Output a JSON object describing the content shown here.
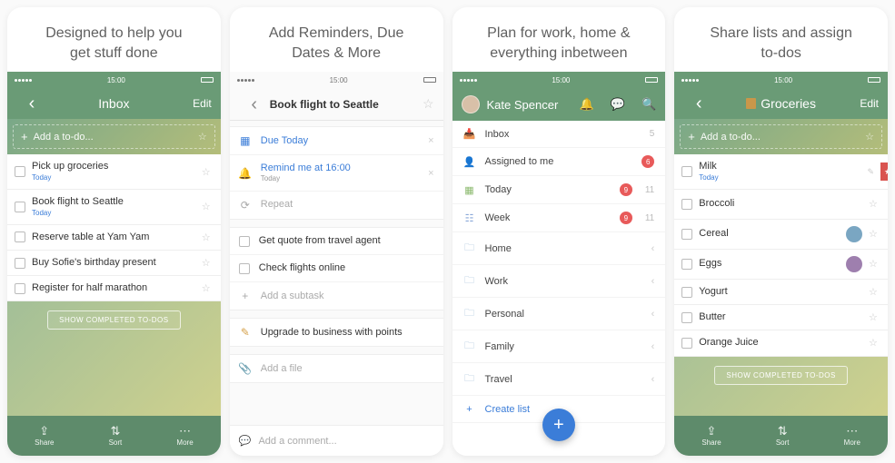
{
  "captions": {
    "c1l1": "Designed to help you",
    "c1l2": "get stuff done",
    "c2l1": "Add Reminders, Due",
    "c2l2": "Dates & More",
    "c3l1": "Plan for work, home &",
    "c3l2": "everything inbetween",
    "c4l1": "Share lists and assign",
    "c4l2": "to-dos"
  },
  "status_time": "15:00",
  "s1": {
    "title": "Inbox",
    "edit": "Edit",
    "add_placeholder": "Add a to-do...",
    "tasks": {
      "t0": {
        "title": "Pick up groceries",
        "sub": "Today"
      },
      "t1": {
        "title": "Book flight to Seattle",
        "sub": "Today"
      },
      "t2": {
        "title": "Reserve table at Yam Yam"
      },
      "t3": {
        "title": "Buy Sofie's birthday present"
      },
      "t4": {
        "title": "Register for half marathon"
      }
    },
    "show_completed": "SHOW COMPLETED TO-DOS"
  },
  "s2": {
    "title": "Book flight to Seattle",
    "due": "Due Today",
    "remind": "Remind me at 16:00",
    "remind_sub": "Today",
    "repeat": "Repeat",
    "sub0": "Get quote from travel agent",
    "sub1": "Check flights online",
    "add_sub": "Add a subtask",
    "note": "Upgrade to business with points",
    "add_file": "Add a file",
    "comment": "Add a comment..."
  },
  "s3": {
    "name": "Kate Spencer",
    "rows": {
      "inbox": {
        "label": "Inbox",
        "count": "5"
      },
      "assigned": {
        "label": "Assigned to me",
        "badge": "6"
      },
      "today": {
        "label": "Today",
        "badge": "9",
        "count": "11"
      },
      "week": {
        "label": "Week",
        "badge": "9",
        "count": "11"
      },
      "home": {
        "label": "Home"
      },
      "work": {
        "label": "Work"
      },
      "personal": {
        "label": "Personal"
      },
      "family": {
        "label": "Family"
      },
      "travel": {
        "label": "Travel"
      }
    },
    "create": "Create list"
  },
  "s4": {
    "title": "Groceries",
    "edit": "Edit",
    "add_placeholder": "Add a to-do...",
    "items": {
      "i0": {
        "title": "Milk",
        "sub": "Today"
      },
      "i1": {
        "title": "Broccoli"
      },
      "i2": {
        "title": "Cereal"
      },
      "i3": {
        "title": "Eggs"
      },
      "i4": {
        "title": "Yogurt"
      },
      "i5": {
        "title": "Butter"
      },
      "i6": {
        "title": "Orange Juice"
      }
    },
    "show_completed": "SHOW COMPLETED TO-DOS"
  },
  "toolbar": {
    "share": "Share",
    "sort": "Sort",
    "more": "More"
  },
  "colors": {
    "assignees": {
      "a1": "#b78a58",
      "a2": "#7aa6c2",
      "a3": "#9e7fae"
    }
  }
}
